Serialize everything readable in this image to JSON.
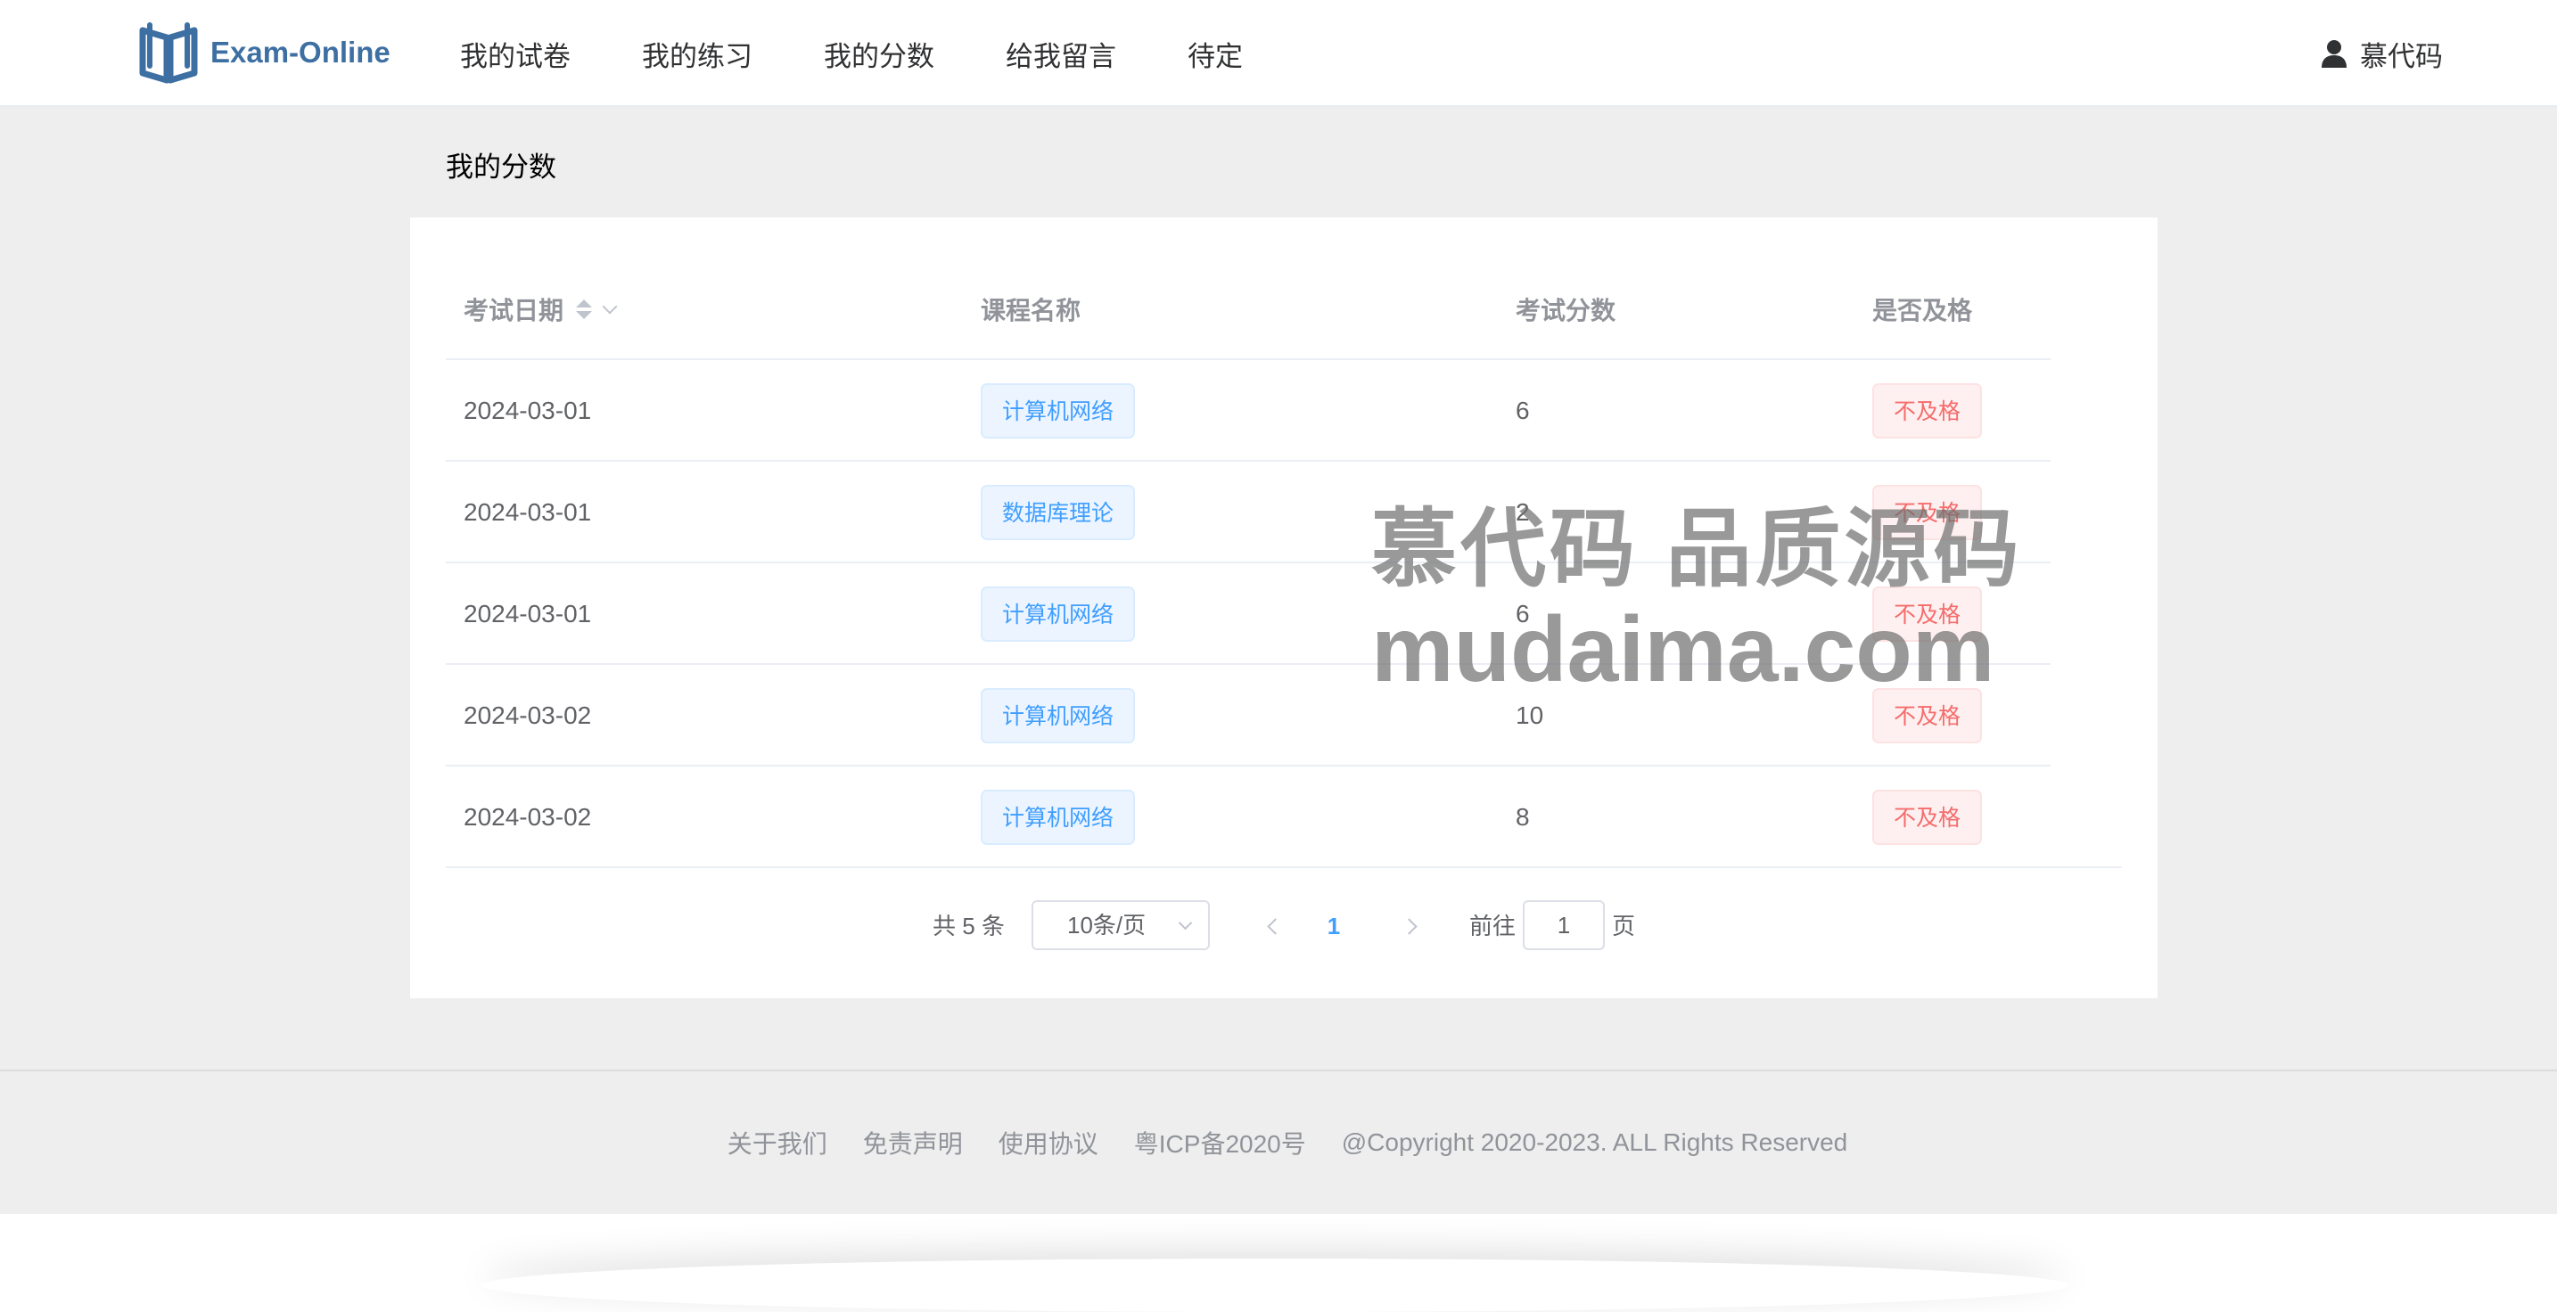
{
  "app": {
    "logo_text": "Exam-Online",
    "nav": [
      "我的试卷",
      "我的练习",
      "我的分数",
      "给我留言",
      "待定"
    ],
    "user_name": "慕代码"
  },
  "page": {
    "title": "我的分数"
  },
  "table": {
    "headers": [
      "考试日期",
      "课程名称",
      "考试分数",
      "是否及格"
    ],
    "rows": [
      {
        "date": "2024-03-01",
        "course": "计算机网络",
        "score": "6",
        "pass": "不及格"
      },
      {
        "date": "2024-03-01",
        "course": "数据库理论",
        "score": "2",
        "pass": "不及格"
      },
      {
        "date": "2024-03-01",
        "course": "计算机网络",
        "score": "6",
        "pass": "不及格"
      },
      {
        "date": "2024-03-02",
        "course": "计算机网络",
        "score": "10",
        "pass": "不及格"
      },
      {
        "date": "2024-03-02",
        "course": "计算机网络",
        "score": "8",
        "pass": "不及格"
      }
    ]
  },
  "pagination": {
    "total": "共 5 条",
    "page_size": "10条/页",
    "current_page": "1",
    "goto_label": "前往",
    "goto_value": "1",
    "page_suffix": "页"
  },
  "watermark": {
    "line1": "慕代码 品质源码",
    "line2": "mudaima.com"
  },
  "footer": {
    "links": [
      "关于我们",
      "免责声明",
      "使用协议",
      "粤ICP备2020号"
    ],
    "copyright": "@Copyright 2020-2023. ALL Rights Reserved"
  },
  "colors": {
    "brand": "#3d6fa3",
    "primary": "#409eff",
    "danger": "#f56c6c",
    "background": "#eeeeee"
  },
  "icons": {
    "logo": "open-book-icon",
    "user": "user-icon",
    "sort": "sort-caret-icon"
  }
}
